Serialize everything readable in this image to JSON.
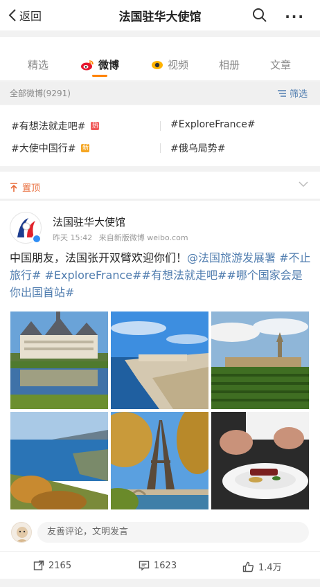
{
  "header": {
    "back_label": "返回",
    "title": "法国驻华大使馆"
  },
  "tabs": [
    {
      "label": "精选",
      "active": false
    },
    {
      "label": "微博",
      "active": true,
      "icon": "weibo-icon"
    },
    {
      "label": "视频",
      "active": false,
      "icon": "video-icon"
    },
    {
      "label": "相册",
      "active": false
    },
    {
      "label": "文章",
      "active": false
    }
  ],
  "filter": {
    "count_label": "全部微博(9291)",
    "button_label": "筛选"
  },
  "topics": [
    {
      "label": "#有想法就走吧#",
      "badge": "热",
      "badge_color": "#f05a5a"
    },
    {
      "label": "#ExploreFrance#"
    },
    {
      "label": "#大使中国行#",
      "badge": "新",
      "badge_color": "#f5a623"
    },
    {
      "label": "#俄乌局势#"
    }
  ],
  "pinned": {
    "label": "置顶"
  },
  "post": {
    "author": "法国驻华大使馆",
    "time": "昨天 15:42",
    "source": "来自新版微博 weibo.com",
    "text_plain": "中国朋友，法国张开双臂欢迎你们！",
    "text_links": "@法国旅游发展署 #不止旅行# #ExploreFrance##有想法就走吧##哪个国家会是你出国首站#",
    "photos": [
      "chateau",
      "coast-cliffs",
      "vineyard",
      "riviera-bay",
      "eiffel-tower",
      "gourmet-dish"
    ]
  },
  "comment": {
    "placeholder": "友善评论，文明发言"
  },
  "actions": {
    "reposts": "2165",
    "comments": "1623",
    "likes": "1.4万"
  },
  "colors": {
    "accent": "#ff8200",
    "link": "#507daf",
    "pin": "#e86b3a"
  }
}
